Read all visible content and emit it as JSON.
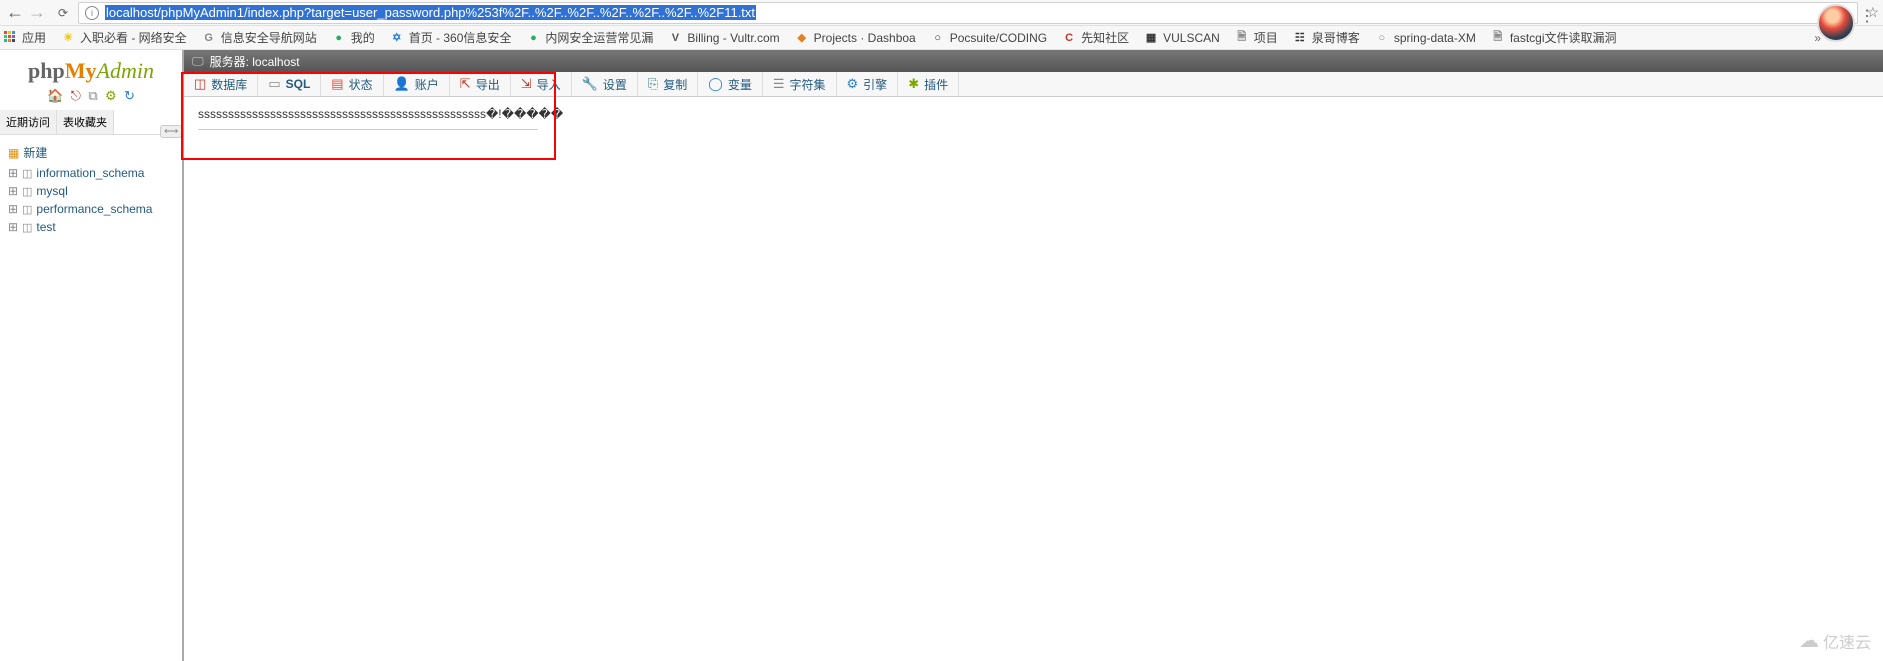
{
  "browser": {
    "url": "localhost/phpMyAdmin1/index.php?target=user_password.php%253f%2F..%2F..%2F..%2F..%2F..%2F..%2F11.txt"
  },
  "bookmarks": {
    "apps": "应用",
    "items": [
      {
        "label": "入职必看 - 网络安全",
        "color": "#f1c40f",
        "glyph": "☀"
      },
      {
        "label": "信息安全导航网站",
        "color": "#888",
        "glyph": "G"
      },
      {
        "label": "我的",
        "color": "#27ae60",
        "glyph": "●"
      },
      {
        "label": "首页 - 360信息安全",
        "color": "#2a7ed2",
        "glyph": "✡"
      },
      {
        "label": "内网安全运营常见漏",
        "color": "#27ae60",
        "glyph": "●"
      },
      {
        "label": "Billing - Vultr.com",
        "color": "#555",
        "glyph": "V"
      },
      {
        "label": "Projects · Dashboa",
        "color": "#e67e22",
        "glyph": "◆"
      },
      {
        "label": "Pocsuite/CODING",
        "color": "#333",
        "glyph": "○"
      },
      {
        "label": "先知社区",
        "color": "#c0392b",
        "glyph": "C"
      },
      {
        "label": "VULSCAN",
        "color": "#333",
        "glyph": "▦"
      },
      {
        "label": "项目",
        "color": "#888",
        "glyph": "🗎"
      },
      {
        "label": "泉哥博客",
        "color": "#333",
        "glyph": "☷"
      },
      {
        "label": "spring-data-XM",
        "color": "#888",
        "glyph": "○"
      },
      {
        "label": "fastcgi文件读取漏洞",
        "color": "#888",
        "glyph": "🗎"
      }
    ]
  },
  "pma": {
    "side_tabs": {
      "recent": "近期访问",
      "fav": "表收藏夹"
    },
    "tree": {
      "new": "新建",
      "dbs": [
        "information_schema",
        "mysql",
        "performance_schema",
        "test"
      ]
    },
    "topbar_label": "服务器: localhost",
    "tabs": [
      {
        "label": "数据库",
        "color": "#c0392b",
        "glyph": "◫"
      },
      {
        "label": "SQL",
        "color": "#888",
        "glyph": "▭",
        "bold": true
      },
      {
        "label": "状态",
        "color": "#e74c3c",
        "glyph": "▤"
      },
      {
        "label": "账户",
        "color": "#e67e22",
        "glyph": "👤"
      },
      {
        "label": "导出",
        "color": "#c0392b",
        "glyph": "⇱"
      },
      {
        "label": "导入",
        "color": "#c0392b",
        "glyph": "⇲"
      },
      {
        "label": "设置",
        "color": "#7aa600",
        "glyph": "🔧"
      },
      {
        "label": "复制",
        "color": "#3b8686",
        "glyph": "⎘"
      },
      {
        "label": "变量",
        "color": "#2a7ed2",
        "glyph": "◯"
      },
      {
        "label": "字符集",
        "color": "#888",
        "glyph": "☰"
      },
      {
        "label": "引擎",
        "color": "#2a7ed2",
        "glyph": "⚙"
      },
      {
        "label": "插件",
        "color": "#7aa600",
        "glyph": "✱"
      }
    ],
    "content_text": "ssssssssssssssssssssssssssssssssssssssssssssssss�!�����"
  },
  "watermark": "亿速云"
}
